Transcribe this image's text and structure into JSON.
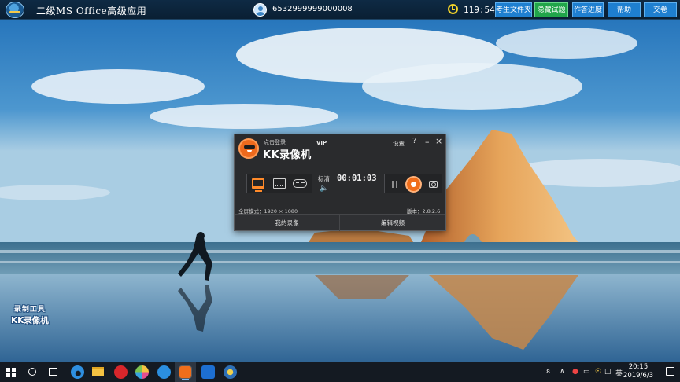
{
  "exam_bar": {
    "title": "二级MS Office高级应用",
    "user_id": "6532999999000008",
    "time": "119:54",
    "buttons": [
      "考生文件夹",
      "隐藏试题",
      "作答进度",
      "帮助",
      "交卷"
    ],
    "accent": "#1e7fd0",
    "active_button_color": "#21a54a"
  },
  "recorder": {
    "login": "点击登录",
    "vip": "VIP",
    "brand": "KK录像机",
    "settings": "设置",
    "help": "?",
    "minimize": "–",
    "close": "×",
    "quality": "标清",
    "timer": "00:01:03",
    "fullscreen": "全屏模式：1920 × 1080",
    "version": "版本：2.8.2.6",
    "my_recordings": "我的录像",
    "edit_video": "编辑视频",
    "record_color": "#f06e1b"
  },
  "watermark": {
    "line1": "录制工具",
    "line2": "KK录像机"
  },
  "taskbar": {
    "tray_person": "ጸ",
    "ime": "英",
    "clock_time": "20:15",
    "clock_date": "2019/6/3"
  }
}
